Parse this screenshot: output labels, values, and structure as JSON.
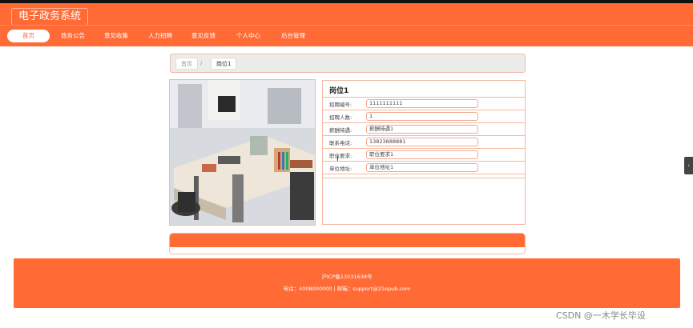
{
  "site": {
    "title": "电子政务系统"
  },
  "nav": {
    "items": [
      {
        "label": "首页",
        "active": true
      },
      {
        "label": "政务公告"
      },
      {
        "label": "意见收集"
      },
      {
        "label": "人力招聘"
      },
      {
        "label": "意见反馈"
      },
      {
        "label": "个人中心"
      },
      {
        "label": "后台管理"
      }
    ]
  },
  "breadcrumb": {
    "home": "首页",
    "separator": "/",
    "current": "岗位1"
  },
  "detail": {
    "title": "岗位1",
    "fields": [
      {
        "label": "招聘编号:",
        "value": "1111111111"
      },
      {
        "label": "招聘人数:",
        "value": "1"
      },
      {
        "label": "薪酬待遇:",
        "value": "薪酬待遇1"
      },
      {
        "label": "联系电话:",
        "value": "13823888881"
      },
      {
        "label": "职位要求:",
        "value": "职位要求1"
      },
      {
        "label": "单位地址:",
        "value": "单位地址1"
      }
    ]
  },
  "footer": {
    "icp": "沪ICP备13031638号",
    "contact": "电话：4008000000 | 邮箱：support@21epub.com"
  },
  "side_toggle": "‹",
  "watermark": "CSDN @一木学长毕设",
  "colors": {
    "accent": "#ff6a35",
    "border": "#f4b8a2"
  }
}
